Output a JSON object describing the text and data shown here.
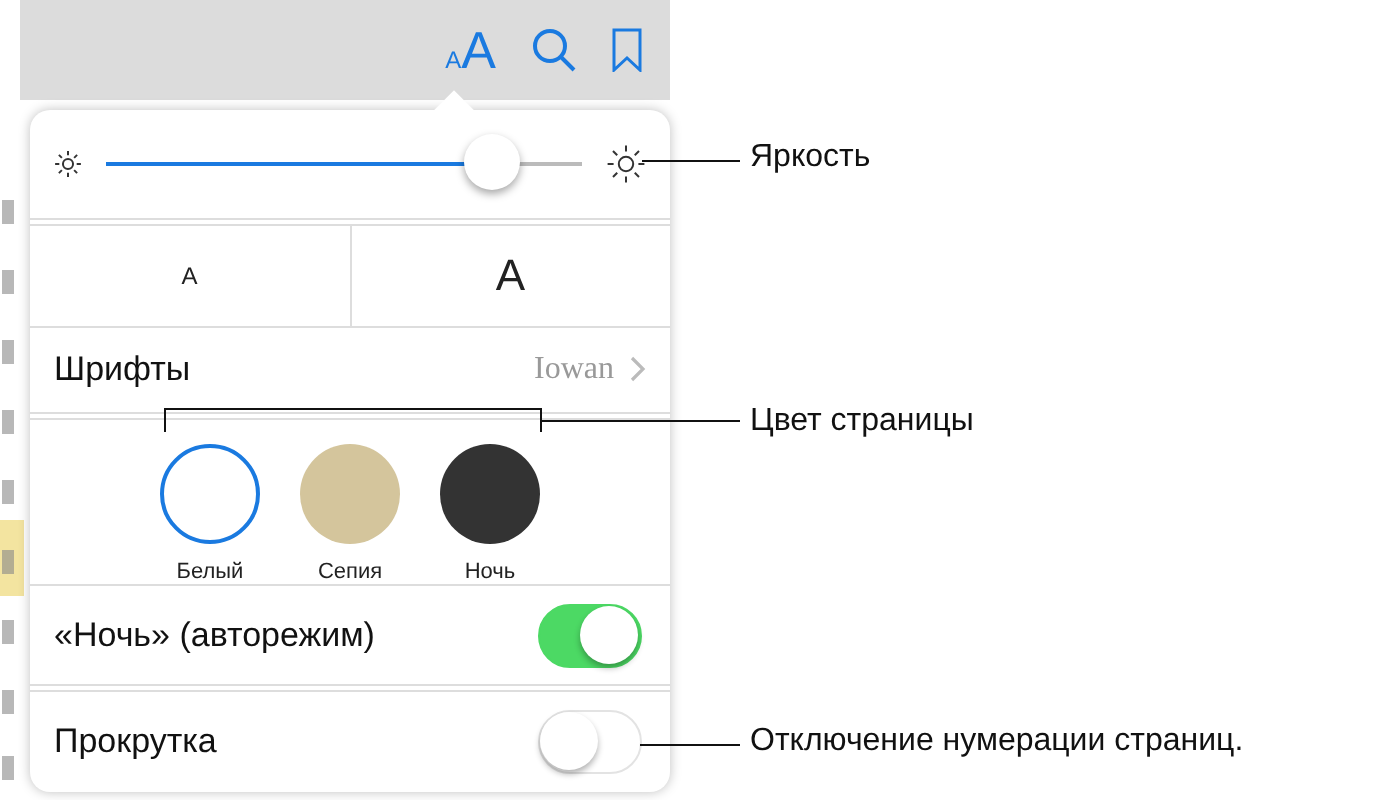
{
  "toolbar": {
    "font_button": {
      "small": "A",
      "large": "A"
    }
  },
  "brightness": {
    "level": 0.81
  },
  "font_size": {
    "smaller": "A",
    "larger": "A"
  },
  "fonts_row": {
    "label": "Шрифты",
    "value": "Iowan"
  },
  "page_colors": [
    {
      "label": "Белый",
      "color": "#ffffff",
      "selected": true
    },
    {
      "label": "Сепия",
      "color": "#d4c59c",
      "selected": false
    },
    {
      "label": "Ночь",
      "color": "#333333",
      "selected": false
    }
  ],
  "toggles": [
    {
      "label": "«Ночь» (авторежим)",
      "on": true
    },
    {
      "label": "Прокрутка",
      "on": false
    }
  ],
  "callouts": [
    {
      "text": "Яркость"
    },
    {
      "text": "Цвет страницы"
    },
    {
      "text": "Отключение нумерации страниц."
    }
  ]
}
